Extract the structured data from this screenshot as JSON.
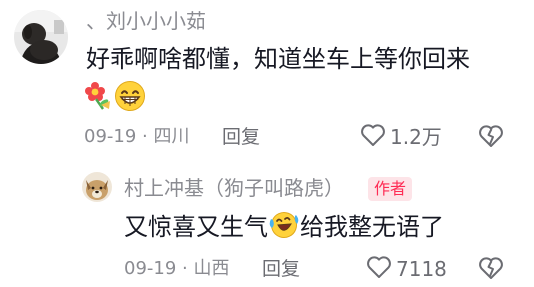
{
  "comment": {
    "username": "、刘小小小茹",
    "text": "好乖啊啥都懂，知道坐车上等你回来",
    "emojis": [
      "flower-emoji",
      "grin-emoji"
    ],
    "date": "09-19",
    "separator": "·",
    "location": "四川",
    "reply_label": "回复",
    "like_count": "1.2万"
  },
  "reply": {
    "username": "村上冲基（狗子叫路虎）",
    "author_badge": "作者",
    "text_before": "又惊喜又生气",
    "inline_emoji": "laugh-cry-emoji",
    "text_after": "给我整无语了",
    "date": "09-19",
    "separator": "·",
    "location": "山西",
    "reply_label": "回复",
    "like_count": "7118"
  },
  "colors": {
    "author_badge_text": "#fe2c55",
    "author_badge_bg": "#fde4e8",
    "secondary_text": "#8a8b91"
  }
}
